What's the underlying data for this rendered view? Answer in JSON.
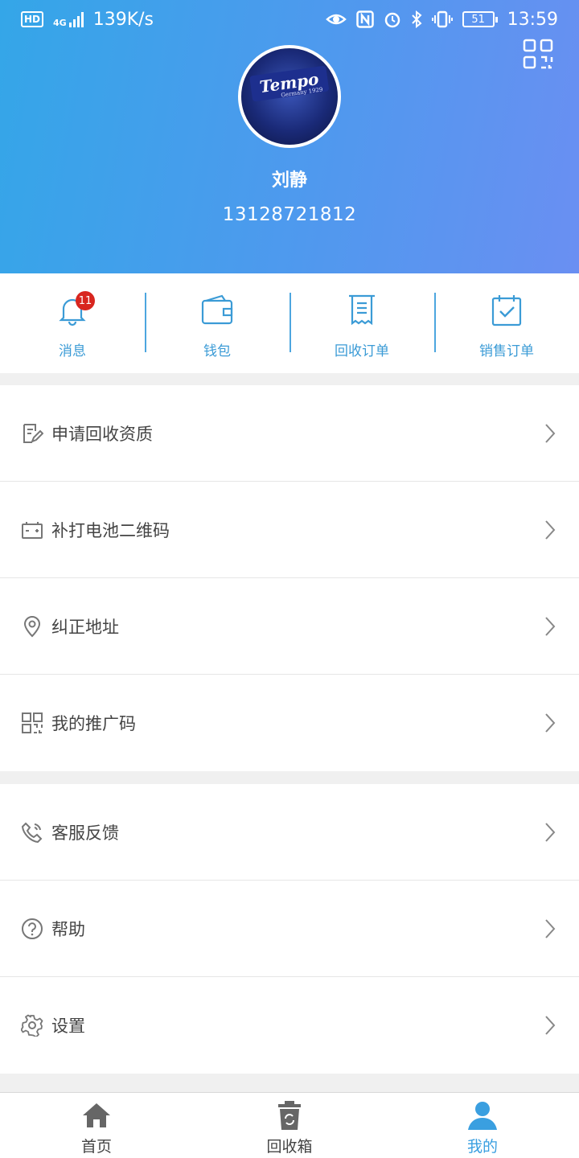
{
  "status_bar": {
    "network_speed": "139K/s",
    "signal_label": "4G",
    "hd_label": "HD",
    "battery_level": "51",
    "time": "13:59"
  },
  "profile": {
    "name": "刘静",
    "phone": "13128721812",
    "avatar_brand": "Tempo",
    "avatar_sub": "Germany 1929"
  },
  "quick_actions": [
    {
      "label": "消息",
      "badge": "11"
    },
    {
      "label": "钱包"
    },
    {
      "label": "回收订单"
    },
    {
      "label": "销售订单"
    }
  ],
  "menu_group_1": [
    {
      "label": "申请回收资质",
      "icon": "edit-doc-icon"
    },
    {
      "label": "补打电池二维码",
      "icon": "battery-icon"
    },
    {
      "label": "纠正地址",
      "icon": "location-pin-icon"
    },
    {
      "label": "我的推广码",
      "icon": "qr-code-icon"
    }
  ],
  "menu_group_2": [
    {
      "label": "客服反馈",
      "icon": "phone-icon"
    },
    {
      "label": "帮助",
      "icon": "help-icon"
    },
    {
      "label": "设置",
      "icon": "gear-icon"
    }
  ],
  "tabs": [
    {
      "label": "首页",
      "icon": "home-icon",
      "active": false
    },
    {
      "label": "回收箱",
      "icon": "recycle-bin-icon",
      "active": false
    },
    {
      "label": "我的",
      "icon": "user-icon",
      "active": true
    }
  ],
  "colors": {
    "header_start": "#34a6e8",
    "header_end": "#6a8ff2",
    "accent": "#3a9fe0",
    "badge": "#d8261f"
  }
}
